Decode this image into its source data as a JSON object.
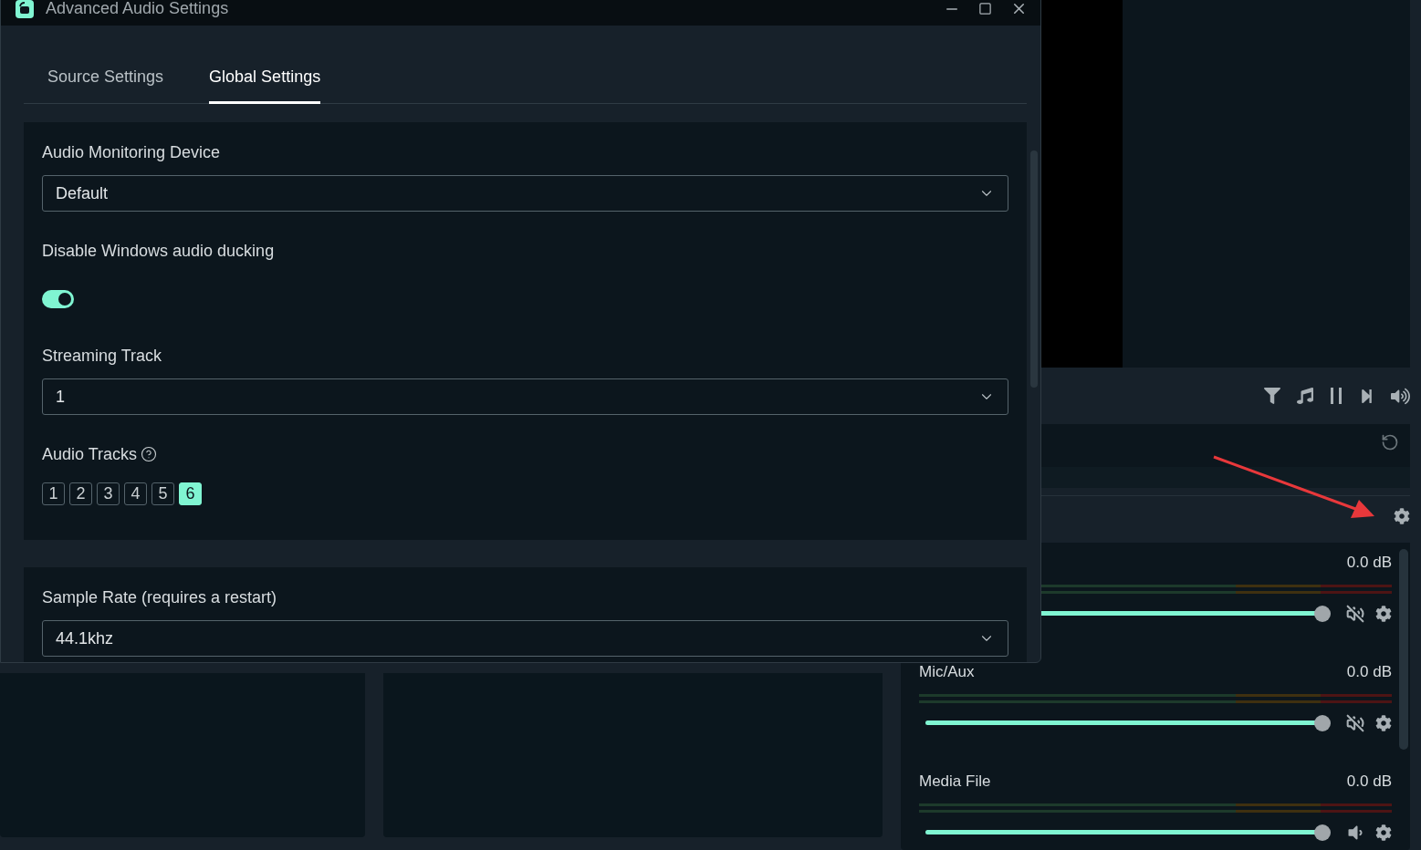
{
  "window": {
    "title": "Advanced Audio Settings"
  },
  "tabs": [
    {
      "label": "Source Settings",
      "selected": false
    },
    {
      "label": "Global Settings",
      "selected": true
    }
  ],
  "sections": [
    {
      "fields": [
        {
          "kind": "select",
          "label": "Audio Monitoring Device",
          "value": "Default"
        },
        {
          "kind": "toggle",
          "label": "Disable Windows audio ducking",
          "on": true
        },
        {
          "kind": "select",
          "label": "Streaming Track",
          "value": "1"
        },
        {
          "kind": "tracks",
          "label": "Audio Tracks",
          "tracks": [
            {
              "label": "1",
              "selected": false
            },
            {
              "label": "2",
              "selected": false
            },
            {
              "label": "3",
              "selected": false
            },
            {
              "label": "4",
              "selected": false
            },
            {
              "label": "5",
              "selected": false
            },
            {
              "label": "6",
              "selected": true
            }
          ]
        }
      ]
    },
    {
      "fields": [
        {
          "kind": "select",
          "label": "Sample Rate (requires a restart)",
          "value": "44.1khz"
        }
      ]
    }
  ],
  "mixer": {
    "sources": [
      {
        "reading": "0.0 dB",
        "level": 0.98,
        "muted": true
      },
      {
        "name": "Mic/Aux",
        "reading": "0.0 dB",
        "level": 0.98,
        "muted": true
      },
      {
        "name": "Media File",
        "reading": "0.0 dB",
        "level": 0.98,
        "muted": false
      }
    ]
  }
}
